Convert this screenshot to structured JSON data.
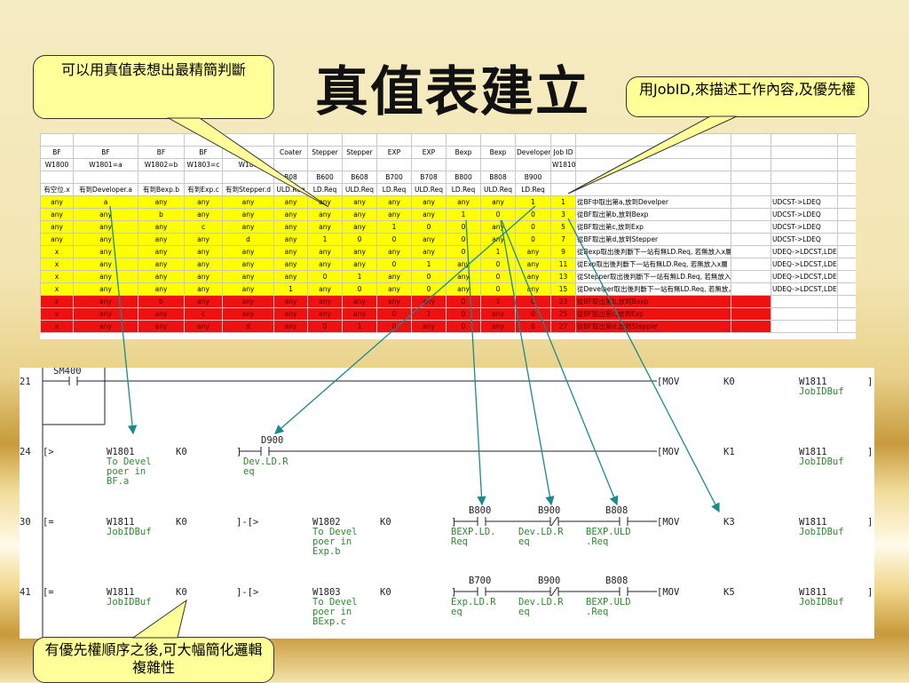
{
  "title": "真值表建立",
  "callouts": {
    "top_left": "可以用真值表想出最精簡判斷",
    "top_right": "用JobID,來描述工作內容,及優先權",
    "bottom_left": "有優先權順序之後,可大幅簡化邏輯複雜性"
  },
  "sheet": {
    "header_rows": [
      [
        "",
        "",
        "",
        "",
        "",
        "",
        "",
        "",
        "",
        "",
        "",
        "",
        "",
        "",
        "",
        "",
        "",
        ""
      ],
      [
        "BF",
        "BF",
        "BF",
        "BF",
        "",
        "Coater",
        "Stepper",
        "Stepper",
        "EXP",
        "EXP",
        "Bexp",
        "Bexp",
        "Developer",
        "Job ID",
        "",
        "",
        "",
        ""
      ],
      [
        "W1800",
        "W1801=a",
        "W1802=b",
        "W1803=c",
        "W180",
        "",
        "",
        "",
        "",
        "",
        "",
        "",
        "",
        "W1810",
        "",
        "",
        "",
        ""
      ],
      [
        "",
        "",
        "",
        "",
        "",
        "B08",
        "B600",
        "B608",
        "B700",
        "B708",
        "B800",
        "B808",
        "B900",
        "",
        "",
        "",
        "",
        ""
      ],
      [
        "有空位.x",
        "有到Developer.a",
        "有到Bexp.b",
        "有到Exp.c",
        "有到Stepper.d",
        "ULD.Req",
        "LD.Req",
        "ULD.Req",
        "LD.Req",
        "ULD.Req",
        "LD.Req",
        "ULD.Req",
        "LD.Req",
        "",
        "",
        "",
        "",
        ""
      ]
    ],
    "yellow_rows": [
      [
        "any",
        "a",
        "any",
        "any",
        "any",
        "any",
        "any",
        "any",
        "any",
        "any",
        "any",
        "any",
        "1",
        "1",
        "從BF中取出第a,放到Develper",
        "",
        "UDCST->LDEQ",
        ""
      ],
      [
        "any",
        "any",
        "b",
        "any",
        "any",
        "any",
        "any",
        "any",
        "any",
        "any",
        "1",
        "0",
        "0",
        "3",
        "從BF取出第b,放到Bexp",
        "",
        "UDCST->LDEQ",
        ""
      ],
      [
        "any",
        "any",
        "any",
        "c",
        "any",
        "any",
        "any",
        "any",
        "1",
        "0",
        "0",
        "any",
        "0",
        "5",
        "從BF取出第c,放到Exp",
        "",
        "UDCST->LDEQ",
        ""
      ],
      [
        "any",
        "any",
        "any",
        "any",
        "d",
        "any",
        "1",
        "0",
        "0",
        "any",
        "0",
        "any",
        "0",
        "7",
        "從BF取出第d,放到Stepper",
        "",
        "UDCST->LDEQ",
        ""
      ],
      [
        "x",
        "any",
        "any",
        "any",
        "any",
        "any",
        "any",
        "any",
        "any",
        "any",
        "0",
        "1",
        "any",
        "9",
        "從Bexp取出後判斷下一站有無LD.Req, 若無放入x層",
        "",
        "UDEQ->LDCST,LDEQ",
        ""
      ],
      [
        "x",
        "any",
        "any",
        "any",
        "any",
        "any",
        "any",
        "any",
        "0",
        "1",
        "any",
        "0",
        "any",
        "11",
        "從Exp取出後判斷下一站有無LD.Req, 若無放入x層",
        "",
        "UDEQ->LDCST,LDEQ",
        ""
      ],
      [
        "x",
        "any",
        "any",
        "any",
        "any",
        "any",
        "0",
        "1",
        "any",
        "0",
        "any",
        "0",
        "any",
        "13",
        "從Stepper取出後判斷下一站有無LD.Req, 若無放入x層",
        "",
        "UDEQ->LDCST,LDEQ",
        ""
      ],
      [
        "x",
        "any",
        "any",
        "any",
        "any",
        "1",
        "any",
        "0",
        "any",
        "0",
        "any",
        "0",
        "any",
        "15",
        "從Develper取出後判斷下一站有無LD.Req, 若無放入x層",
        "",
        "UDEQ->LDCST,LDEQ",
        ""
      ]
    ],
    "red_rows": [
      [
        "x",
        "any",
        "b",
        "any",
        "any",
        "any",
        "any",
        "any",
        "any",
        "any",
        "0",
        "1",
        "0",
        "23",
        "從BF取出第b,放到Bexp",
        "",
        "",
        ""
      ],
      [
        "x",
        "any",
        "any",
        "c",
        "any",
        "any",
        "any",
        "any",
        "0",
        "1",
        "0",
        "any",
        "0",
        "25",
        "從BF取出第c,放到Exp",
        "",
        "",
        ""
      ],
      [
        "x",
        "any",
        "any",
        "any",
        "d",
        "any",
        "0",
        "1",
        "0",
        "any",
        "0",
        "any",
        "0",
        "27",
        "從BF取出第d,放到Stepper",
        "",
        "",
        ""
      ]
    ]
  },
  "ladder": {
    "rungs": [
      {
        "num": "21",
        "start": "SM400",
        "op": "[MOV",
        "k": "K0",
        "dest": "W1811",
        "dest_label": "JobIDBuf"
      },
      {
        "num": "24",
        "start": "[>",
        "w": "W1801",
        "wk": "K0",
        "wlabel": [
          "To Devel",
          "poer in",
          "BF.a"
        ],
        "contact": "D900",
        "contact_label": [
          "Dev.LD.R",
          "eq"
        ],
        "op": "[MOV",
        "k": "K1",
        "dest": "W1811",
        "dest_label": "JobIDBuf"
      },
      {
        "num": "30",
        "start": "[=",
        "w": "W1811",
        "wlabel": [
          "JobIDBuf"
        ],
        "wk": "K0",
        "cmp": "]-[>",
        "w2": "W1802",
        "w2k": "K0",
        "w2label": [
          "To Devel",
          "poer in",
          "Exp.b"
        ],
        "c1": "B800",
        "c1label": [
          "BEXP.LD.",
          "Req"
        ],
        "c2": "B900",
        "c2label": [
          "Dev.LD.R",
          "eq"
        ],
        "c3": "B808",
        "c3label": [
          "BEXP.ULD",
          ".Req"
        ],
        "op": "[MOV",
        "k": "K3",
        "dest": "W1811",
        "dest_label": "JobIDBuf"
      },
      {
        "num": "41",
        "start": "[=",
        "w": "W1811",
        "wlabel": [
          "JobIDBuf"
        ],
        "wk": "K0",
        "cmp": "]-[>",
        "w2": "W1803",
        "w2k": "K0",
        "w2label": [
          "To Devel",
          "poer in",
          "BExp.c"
        ],
        "c1": "B700",
        "c1label": [
          "Exp.LD.R",
          "eq"
        ],
        "c2": "B900",
        "c2label": [
          "Dev.LD.R",
          "eq"
        ],
        "c3": "B808",
        "c3label": [
          "BEXP.ULD",
          ".Req"
        ],
        "op": "[MOV",
        "k": "K5",
        "dest": "W1811",
        "dest_label": "JobIDBuf"
      }
    ]
  },
  "colors": {
    "callout_bg": "#ffff99",
    "yellow": "#ffff00",
    "red": "#ee1111",
    "arrow": "#1a8a8a",
    "ladder_text": "#2c8a2c"
  }
}
